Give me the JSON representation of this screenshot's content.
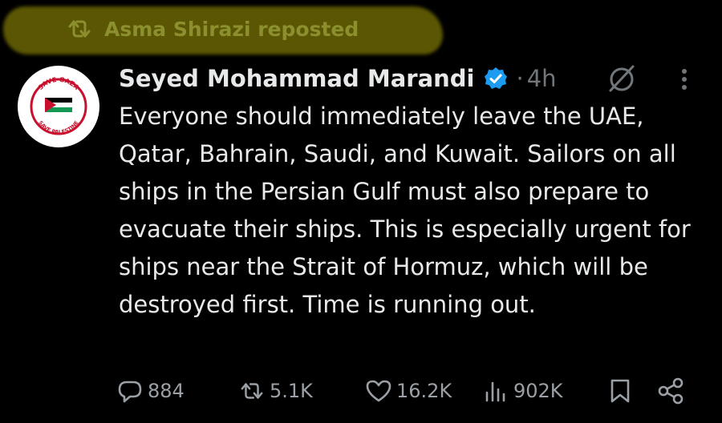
{
  "repost": {
    "label": "Asma Shirazi reposted",
    "highlight_color": "#6f6a04",
    "icon": "repost-icon"
  },
  "author": {
    "name": "Seyed Mohammad Marandi",
    "verified": true,
    "dot": "·",
    "time": "4h",
    "avatar_text_top": "SAVE GAZA",
    "avatar_text_bottom": "SAVE PALESTINE"
  },
  "tweet": {
    "text": "Everyone should immediately leave the UAE, Qatar, Bahrain, Saudi, and Kuwait. Sailors on all ships in the Persian Gulf must also prepare to evacuate their ships. This is especially urgent for ships near the Strait of Hormuz, which will be destroyed first. Time is running out."
  },
  "actions": {
    "replies": "884",
    "reposts": "5.1K",
    "likes": "16.2K",
    "views": "902K"
  },
  "colors": {
    "background": "#000000",
    "text": "#e7e9ea",
    "muted": "#71767b",
    "verified": "#1d9bf0"
  }
}
